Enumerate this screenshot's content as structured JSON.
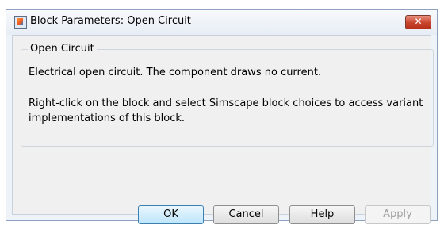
{
  "window": {
    "title": "Block Parameters: Open Circuit",
    "icon": "simulink-block-icon",
    "close_label": "✕"
  },
  "group": {
    "legend": "Open Circuit",
    "description": "Electrical open circuit. The component draws no current.",
    "help_text": "Right-click on the block and select Simscape block choices to access variant implementations of this block."
  },
  "buttons": {
    "ok": "OK",
    "cancel": "Cancel",
    "help": "Help",
    "apply": "Apply"
  },
  "colors": {
    "close_button": "#c8432c",
    "default_button_border": "#3c7fb1"
  }
}
